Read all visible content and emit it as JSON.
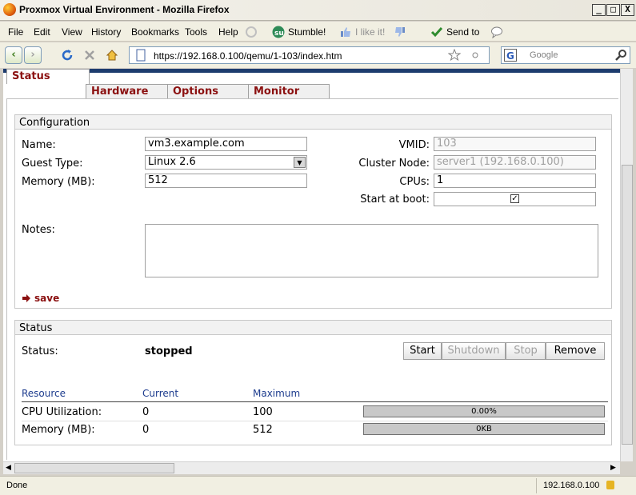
{
  "window": {
    "title": "Proxmox Virtual Environment - Mozilla Firefox",
    "min": "_",
    "max": "□",
    "close": "X"
  },
  "menu": {
    "file": "File",
    "edit": "Edit",
    "view": "View",
    "history": "History",
    "bookmarks": "Bookmarks",
    "tools": "Tools",
    "help": "Help",
    "stumble": "Stumble!",
    "ilike": "I like it!",
    "sendto": "Send to"
  },
  "nav": {
    "url": "https://192.168.0.100/qemu/1-103/index.htm",
    "search_placeholder": "Google"
  },
  "tabs": [
    "Status",
    "Hardware",
    "Options",
    "Monitor"
  ],
  "config": {
    "legend": "Configuration",
    "name_label": "Name:",
    "name_value": "vm3.example.com",
    "guest_label": "Guest Type:",
    "guest_value": "Linux 2.6",
    "memory_label": "Memory (MB):",
    "memory_value": "512",
    "vmid_label": "VMID:",
    "vmid_value": "103",
    "node_label": "Cluster Node:",
    "node_value": "server1 (192.168.0.100)",
    "cpus_label": "CPUs:",
    "cpus_value": "1",
    "boot_label": "Start at boot:",
    "boot_checked": true,
    "notes_label": "Notes:",
    "notes_value": "",
    "save_label": "save"
  },
  "status": {
    "legend": "Status",
    "status_label": "Status:",
    "status_value": "stopped",
    "buttons": {
      "start": "Start",
      "shutdown": "Shutdown",
      "stop": "Stop",
      "remove": "Remove"
    },
    "columns": {
      "resource": "Resource",
      "current": "Current",
      "maximum": "Maximum"
    },
    "rows": [
      {
        "resource": "CPU Utilization:",
        "current": "0",
        "maximum": "100",
        "gauge": "0.00%",
        "fraction": 0
      },
      {
        "resource": "Memory (MB):",
        "current": "0",
        "maximum": "512",
        "gauge": "0KB",
        "fraction": 0
      }
    ]
  },
  "statusbar": {
    "text": "Done",
    "host": "192.168.0.100"
  }
}
